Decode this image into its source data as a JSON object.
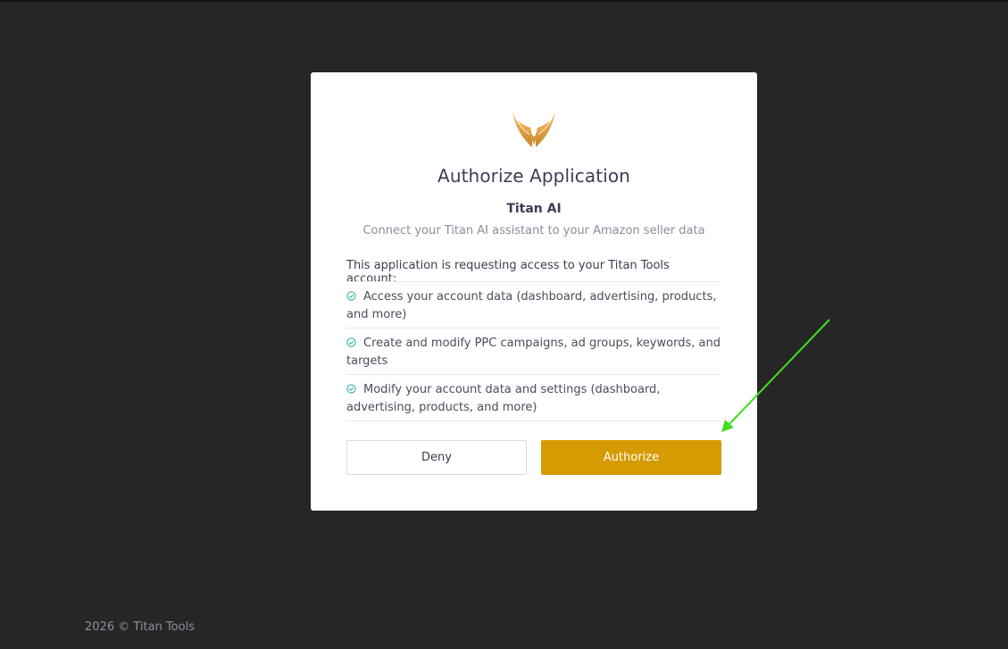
{
  "dialog": {
    "title": "Authorize Application",
    "app_name": "Titan AI",
    "app_description": "Connect your Titan AI assistant to your Amazon seller data",
    "request_text": "This application is requesting access to your Titan Tools account:",
    "permissions": [
      "Access your account data (dashboard, advertising, products, and more)",
      "Create and modify PPC campaigns, ad groups, keywords, and targets",
      "Modify your account data and settings (dashboard, advertising, products, and more)"
    ],
    "deny_label": "Deny",
    "authorize_label": "Authorize"
  },
  "footer": {
    "copyright": "2026 © Titan Tools"
  },
  "icons": {
    "logo": "titan-wings-logo",
    "permission": "check-circle-icon",
    "annotation": "green-arrow-annotation"
  },
  "colors": {
    "background": "#262626",
    "card": "#ffffff",
    "accent": "#d59b00",
    "check": "#2fb5a5",
    "annotation_arrow": "#44dd22"
  }
}
